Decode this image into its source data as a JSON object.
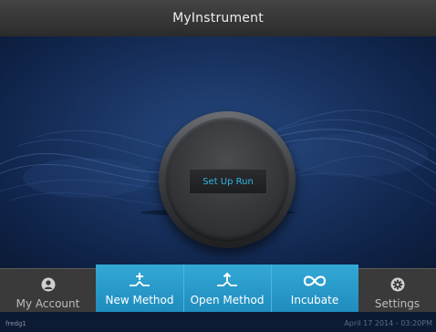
{
  "window": {
    "title": "MyInstrument"
  },
  "main": {
    "run_button_label": "Set Up Run"
  },
  "nav": {
    "items": [
      {
        "label": "My Account",
        "icon": "user-icon",
        "active": false
      },
      {
        "label": "New Method",
        "icon": "new-method-icon",
        "active": true
      },
      {
        "label": "Open Method",
        "icon": "open-method-icon",
        "active": true
      },
      {
        "label": "Incubate",
        "icon": "infinity-icon",
        "active": true
      },
      {
        "label": "Settings",
        "icon": "gear-icon",
        "active": false
      }
    ]
  },
  "status": {
    "user": "fredg1",
    "datetime": "April 17 2014 - 03:20PM"
  },
  "colors": {
    "accent": "#2fb8e3",
    "panel_blue": "#2a9dcc",
    "background": "#1a3563"
  }
}
